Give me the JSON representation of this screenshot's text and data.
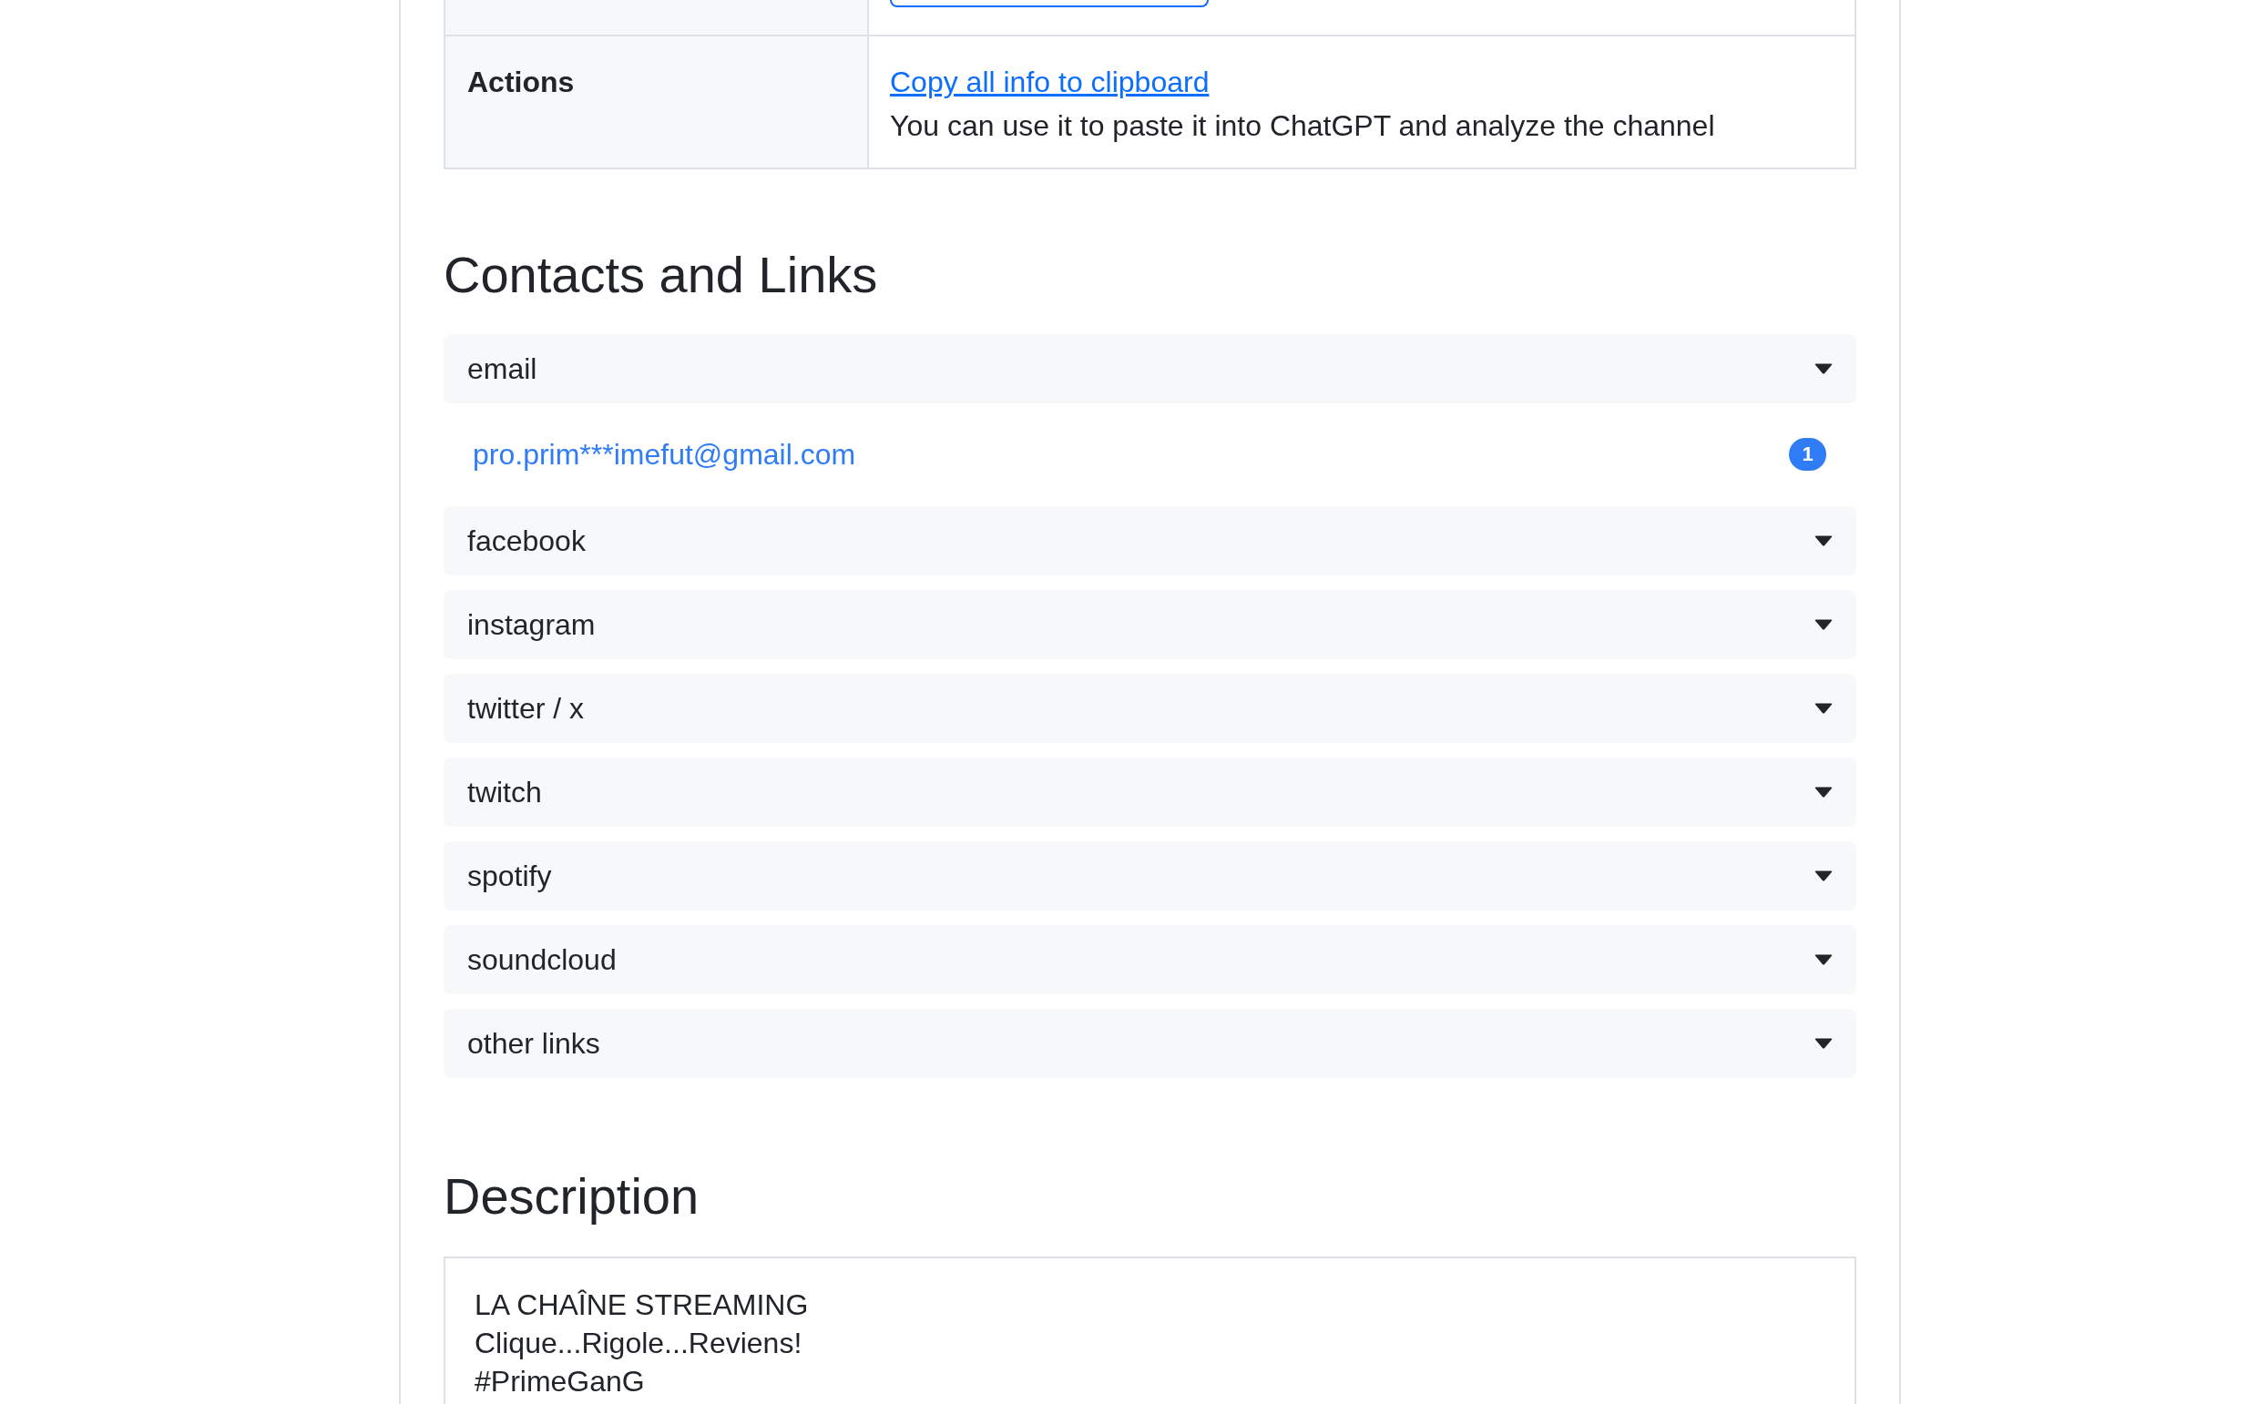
{
  "info_table": {
    "rows": [
      {
        "kind": "button_edge"
      },
      {
        "kind": "actions",
        "label": "Actions",
        "link": "Copy all info to clipboard",
        "note": "You can use it to paste it into ChatGPT and analyze the channel"
      }
    ]
  },
  "contacts": {
    "title": "Contacts and Links",
    "groups": [
      {
        "label": "email",
        "links": [
          {
            "text": "pro.prim***imefut@gmail.com",
            "count": "1"
          }
        ]
      },
      {
        "label": "facebook"
      },
      {
        "label": "instagram"
      },
      {
        "label": "twitter / x"
      },
      {
        "label": "twitch"
      },
      {
        "label": "spotify"
      },
      {
        "label": "soundcloud"
      },
      {
        "label": "other links"
      }
    ]
  },
  "description": {
    "title": "Description",
    "lines": [
      "LA CHAÎNE STREAMING",
      "Clique...Rigole...Reviens!",
      "#PrimeGanG"
    ]
  }
}
